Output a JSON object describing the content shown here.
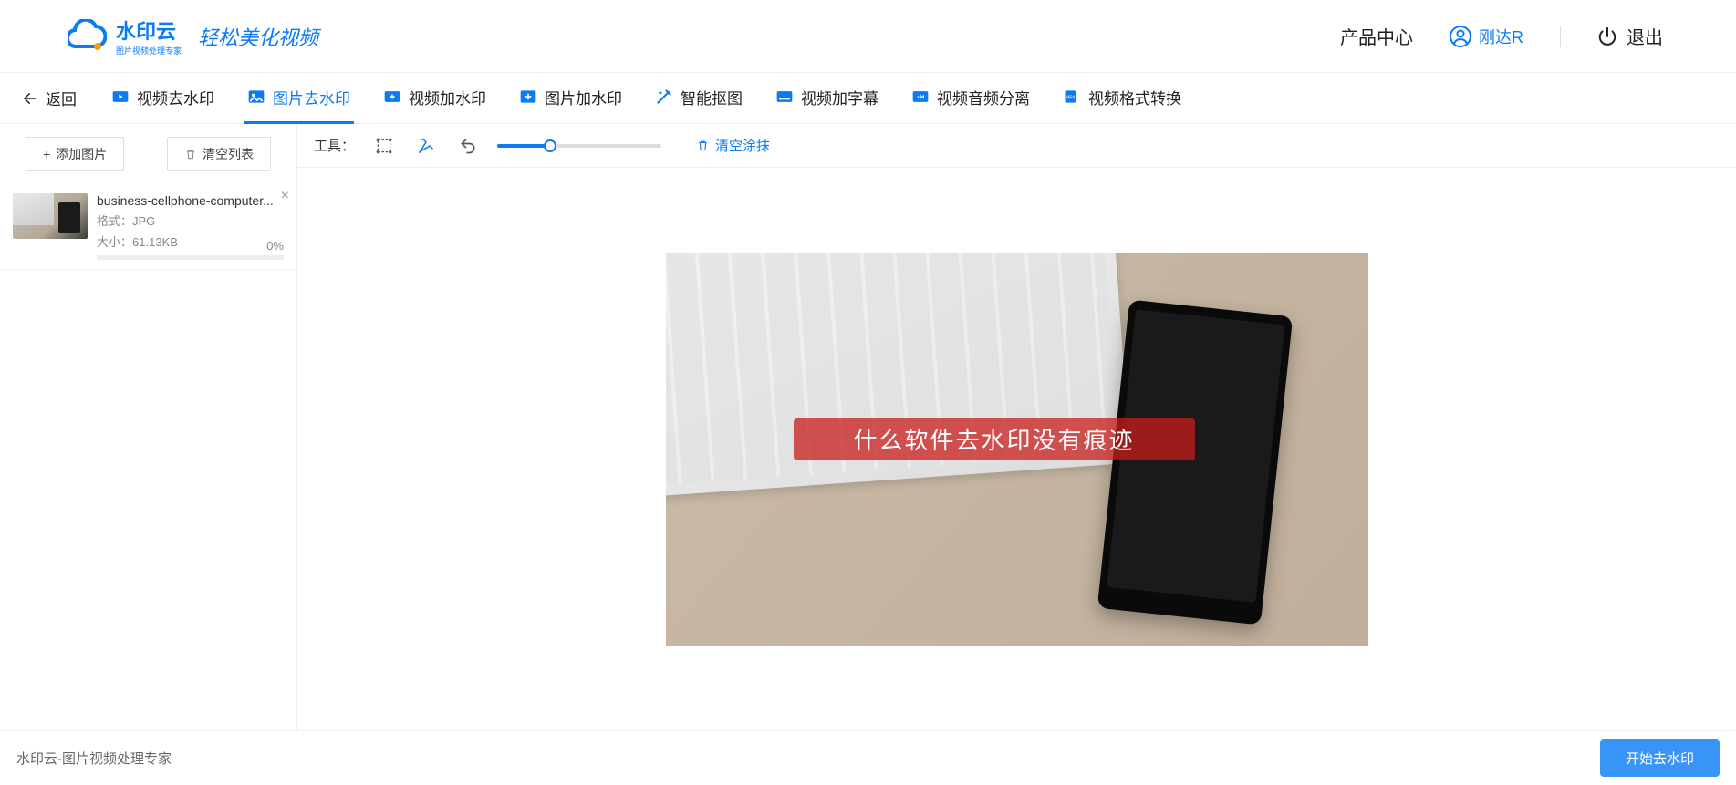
{
  "brand": {
    "title": "水印云",
    "subtitle": "图片视频处理专家",
    "script": "轻松美化视频"
  },
  "header": {
    "product_center": "产品中心",
    "username": "刚达R",
    "exit": "退出"
  },
  "back": {
    "label": "返回"
  },
  "tabs": [
    {
      "label": "视频去水印"
    },
    {
      "label": "图片去水印"
    },
    {
      "label": "视频加水印"
    },
    {
      "label": "图片加水印"
    },
    {
      "label": "智能抠图"
    },
    {
      "label": "视频加字幕"
    },
    {
      "label": "视频音频分离"
    },
    {
      "label": "视频格式转换"
    }
  ],
  "sidebar": {
    "add_btn": "添加图片",
    "clear_btn": "清空列表",
    "file": {
      "name": "business-cellphone-computer...",
      "format_label": "格式：",
      "format_value": "JPG",
      "size_label": "大小：",
      "size_value": "61.13KB",
      "progress_pct": "0%"
    }
  },
  "toolbar": {
    "label": "工具：",
    "clear_smear": "清空涂抹"
  },
  "canvas": {
    "watermark_text": "什么软件去水印没有痕迹"
  },
  "footer": {
    "text": "水印云-图片视频处理专家",
    "action": "开始去水印"
  },
  "colors": {
    "accent": "#0b7af5"
  }
}
